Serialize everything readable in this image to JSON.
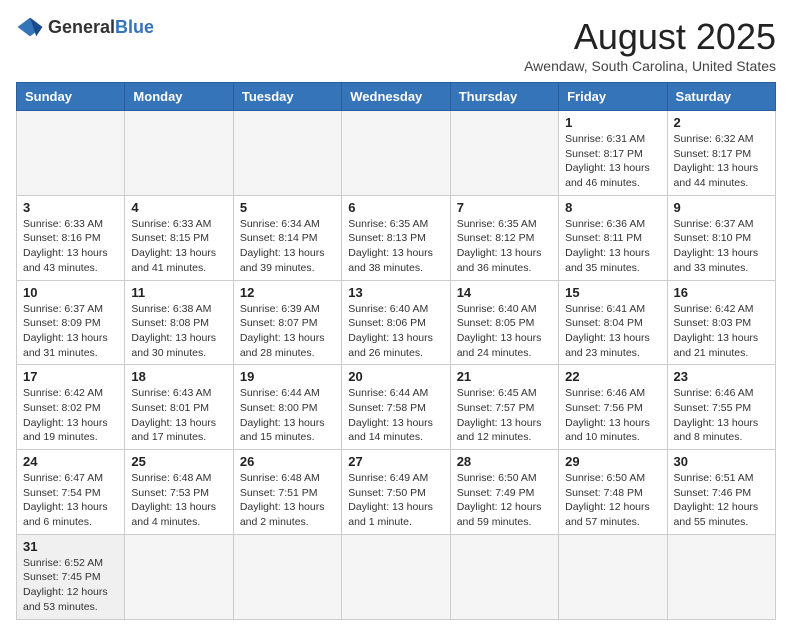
{
  "logo": {
    "text_general": "General",
    "text_blue": "Blue"
  },
  "header": {
    "month_year": "August 2025",
    "location": "Awendaw, South Carolina, United States"
  },
  "days_of_week": [
    "Sunday",
    "Monday",
    "Tuesday",
    "Wednesday",
    "Thursday",
    "Friday",
    "Saturday"
  ],
  "weeks": [
    [
      {
        "day": "",
        "info": ""
      },
      {
        "day": "",
        "info": ""
      },
      {
        "day": "",
        "info": ""
      },
      {
        "day": "",
        "info": ""
      },
      {
        "day": "",
        "info": ""
      },
      {
        "day": "1",
        "info": "Sunrise: 6:31 AM\nSunset: 8:17 PM\nDaylight: 13 hours and 46 minutes."
      },
      {
        "day": "2",
        "info": "Sunrise: 6:32 AM\nSunset: 8:17 PM\nDaylight: 13 hours and 44 minutes."
      }
    ],
    [
      {
        "day": "3",
        "info": "Sunrise: 6:33 AM\nSunset: 8:16 PM\nDaylight: 13 hours and 43 minutes."
      },
      {
        "day": "4",
        "info": "Sunrise: 6:33 AM\nSunset: 8:15 PM\nDaylight: 13 hours and 41 minutes."
      },
      {
        "day": "5",
        "info": "Sunrise: 6:34 AM\nSunset: 8:14 PM\nDaylight: 13 hours and 39 minutes."
      },
      {
        "day": "6",
        "info": "Sunrise: 6:35 AM\nSunset: 8:13 PM\nDaylight: 13 hours and 38 minutes."
      },
      {
        "day": "7",
        "info": "Sunrise: 6:35 AM\nSunset: 8:12 PM\nDaylight: 13 hours and 36 minutes."
      },
      {
        "day": "8",
        "info": "Sunrise: 6:36 AM\nSunset: 8:11 PM\nDaylight: 13 hours and 35 minutes."
      },
      {
        "day": "9",
        "info": "Sunrise: 6:37 AM\nSunset: 8:10 PM\nDaylight: 13 hours and 33 minutes."
      }
    ],
    [
      {
        "day": "10",
        "info": "Sunrise: 6:37 AM\nSunset: 8:09 PM\nDaylight: 13 hours and 31 minutes."
      },
      {
        "day": "11",
        "info": "Sunrise: 6:38 AM\nSunset: 8:08 PM\nDaylight: 13 hours and 30 minutes."
      },
      {
        "day": "12",
        "info": "Sunrise: 6:39 AM\nSunset: 8:07 PM\nDaylight: 13 hours and 28 minutes."
      },
      {
        "day": "13",
        "info": "Sunrise: 6:40 AM\nSunset: 8:06 PM\nDaylight: 13 hours and 26 minutes."
      },
      {
        "day": "14",
        "info": "Sunrise: 6:40 AM\nSunset: 8:05 PM\nDaylight: 13 hours and 24 minutes."
      },
      {
        "day": "15",
        "info": "Sunrise: 6:41 AM\nSunset: 8:04 PM\nDaylight: 13 hours and 23 minutes."
      },
      {
        "day": "16",
        "info": "Sunrise: 6:42 AM\nSunset: 8:03 PM\nDaylight: 13 hours and 21 minutes."
      }
    ],
    [
      {
        "day": "17",
        "info": "Sunrise: 6:42 AM\nSunset: 8:02 PM\nDaylight: 13 hours and 19 minutes."
      },
      {
        "day": "18",
        "info": "Sunrise: 6:43 AM\nSunset: 8:01 PM\nDaylight: 13 hours and 17 minutes."
      },
      {
        "day": "19",
        "info": "Sunrise: 6:44 AM\nSunset: 8:00 PM\nDaylight: 13 hours and 15 minutes."
      },
      {
        "day": "20",
        "info": "Sunrise: 6:44 AM\nSunset: 7:58 PM\nDaylight: 13 hours and 14 minutes."
      },
      {
        "day": "21",
        "info": "Sunrise: 6:45 AM\nSunset: 7:57 PM\nDaylight: 13 hours and 12 minutes."
      },
      {
        "day": "22",
        "info": "Sunrise: 6:46 AM\nSunset: 7:56 PM\nDaylight: 13 hours and 10 minutes."
      },
      {
        "day": "23",
        "info": "Sunrise: 6:46 AM\nSunset: 7:55 PM\nDaylight: 13 hours and 8 minutes."
      }
    ],
    [
      {
        "day": "24",
        "info": "Sunrise: 6:47 AM\nSunset: 7:54 PM\nDaylight: 13 hours and 6 minutes."
      },
      {
        "day": "25",
        "info": "Sunrise: 6:48 AM\nSunset: 7:53 PM\nDaylight: 13 hours and 4 minutes."
      },
      {
        "day": "26",
        "info": "Sunrise: 6:48 AM\nSunset: 7:51 PM\nDaylight: 13 hours and 2 minutes."
      },
      {
        "day": "27",
        "info": "Sunrise: 6:49 AM\nSunset: 7:50 PM\nDaylight: 13 hours and 1 minute."
      },
      {
        "day": "28",
        "info": "Sunrise: 6:50 AM\nSunset: 7:49 PM\nDaylight: 12 hours and 59 minutes."
      },
      {
        "day": "29",
        "info": "Sunrise: 6:50 AM\nSunset: 7:48 PM\nDaylight: 12 hours and 57 minutes."
      },
      {
        "day": "30",
        "info": "Sunrise: 6:51 AM\nSunset: 7:46 PM\nDaylight: 12 hours and 55 minutes."
      }
    ],
    [
      {
        "day": "31",
        "info": "Sunrise: 6:52 AM\nSunset: 7:45 PM\nDaylight: 12 hours and 53 minutes."
      },
      {
        "day": "",
        "info": ""
      },
      {
        "day": "",
        "info": ""
      },
      {
        "day": "",
        "info": ""
      },
      {
        "day": "",
        "info": ""
      },
      {
        "day": "",
        "info": ""
      },
      {
        "day": "",
        "info": ""
      }
    ]
  ]
}
